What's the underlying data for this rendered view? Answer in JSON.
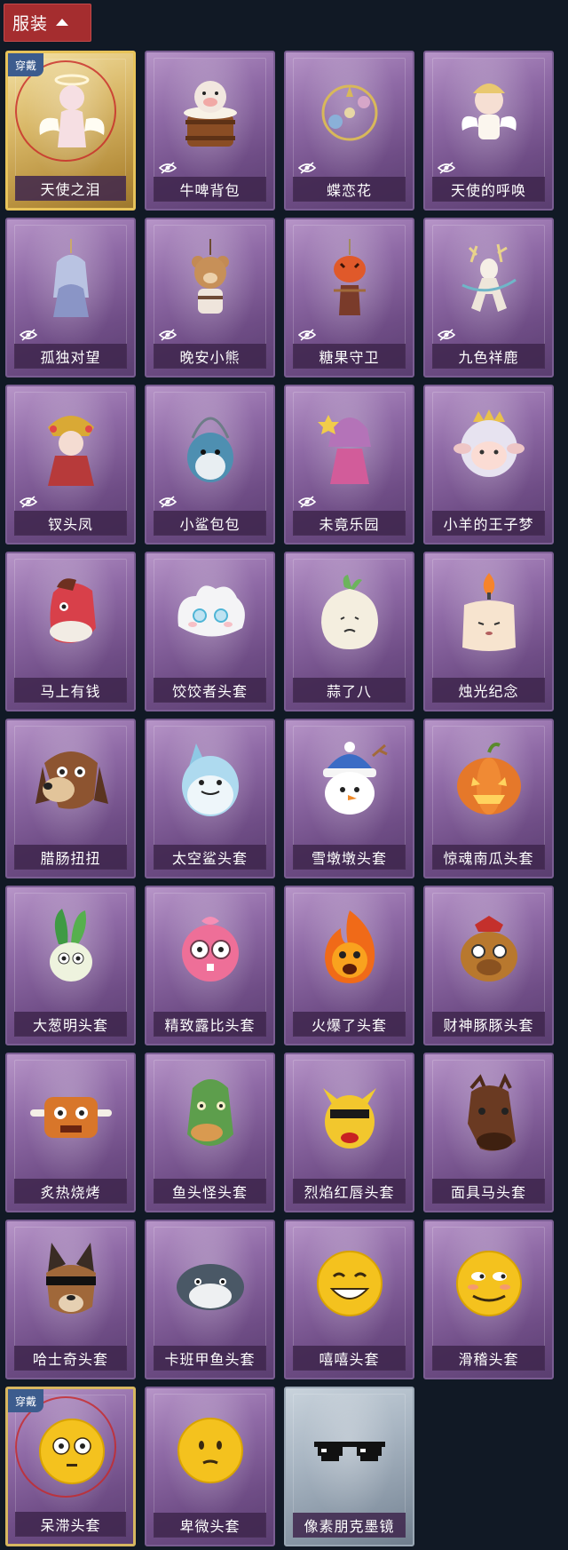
{
  "header": {
    "tab_label": "服装"
  },
  "badges": {
    "wearing": "穿戴"
  },
  "items": [
    {
      "name": "天使之泪",
      "style": "gold",
      "wearing": true,
      "hidden": false,
      "icon": "angel-icon"
    },
    {
      "name": "牛啤背包",
      "style": "purple",
      "wearing": false,
      "hidden": true,
      "icon": "cow-barrel-icon"
    },
    {
      "name": "蝶恋花",
      "style": "purple",
      "wearing": false,
      "hidden": true,
      "icon": "flower-charm-icon"
    },
    {
      "name": "天使的呼唤",
      "style": "purple",
      "wearing": false,
      "hidden": true,
      "icon": "cherub-icon"
    },
    {
      "name": "孤独对望",
      "style": "purple",
      "wearing": false,
      "hidden": true,
      "icon": "doll-charm-icon"
    },
    {
      "name": "晚安小熊",
      "style": "purple",
      "wearing": false,
      "hidden": true,
      "icon": "bear-charm-icon"
    },
    {
      "name": "糖果守卫",
      "style": "purple",
      "wearing": false,
      "hidden": true,
      "icon": "pumpkin-charm-icon"
    },
    {
      "name": "九色祥鹿",
      "style": "purple",
      "wearing": false,
      "hidden": true,
      "icon": "deer-charm-icon"
    },
    {
      "name": "钗头凤",
      "style": "purple",
      "wearing": false,
      "hidden": true,
      "icon": "phoenix-doll-icon"
    },
    {
      "name": "小鲨包包",
      "style": "purple",
      "wearing": false,
      "hidden": true,
      "icon": "shark-bag-icon"
    },
    {
      "name": "未竟乐园",
      "style": "purple",
      "wearing": false,
      "hidden": true,
      "icon": "girl-doll-icon"
    },
    {
      "name": "小羊的王子梦",
      "style": "purple",
      "wearing": false,
      "hidden": false,
      "icon": "sheep-crown-icon"
    },
    {
      "name": "马上有钱",
      "style": "purple",
      "wearing": false,
      "hidden": false,
      "icon": "horse-mask-icon"
    },
    {
      "name": "饺饺者头套",
      "style": "purple",
      "wearing": false,
      "hidden": false,
      "icon": "dumpling-mask-icon"
    },
    {
      "name": "蒜了八",
      "style": "purple",
      "wearing": false,
      "hidden": false,
      "icon": "garlic-mask-icon"
    },
    {
      "name": "烛光纪念",
      "style": "purple",
      "wearing": false,
      "hidden": false,
      "icon": "candle-mask-icon"
    },
    {
      "name": "腊肠扭扭",
      "style": "purple",
      "wearing": false,
      "hidden": false,
      "icon": "dog-mask-icon"
    },
    {
      "name": "太空鲨头套",
      "style": "purple",
      "wearing": false,
      "hidden": false,
      "icon": "space-shark-icon"
    },
    {
      "name": "雪墩墩头套",
      "style": "purple",
      "wearing": false,
      "hidden": false,
      "icon": "snowman-mask-icon"
    },
    {
      "name": "惊魂南瓜头套",
      "style": "purple",
      "wearing": false,
      "hidden": false,
      "icon": "pumpkin-mask-icon"
    },
    {
      "name": "大葱明头套",
      "style": "purple",
      "wearing": false,
      "hidden": false,
      "icon": "scallion-mask-icon"
    },
    {
      "name": "精致露比头套",
      "style": "purple",
      "wearing": false,
      "hidden": false,
      "icon": "pink-beaver-icon"
    },
    {
      "name": "火爆了头套",
      "style": "purple",
      "wearing": false,
      "hidden": false,
      "icon": "fire-mask-icon"
    },
    {
      "name": "财神豚豚头套",
      "style": "purple",
      "wearing": false,
      "hidden": false,
      "icon": "capybara-mask-icon"
    },
    {
      "name": "炙热烧烤",
      "style": "purple",
      "wearing": false,
      "hidden": false,
      "icon": "bbq-mask-icon"
    },
    {
      "name": "鱼头怪头套",
      "style": "purple",
      "wearing": false,
      "hidden": false,
      "icon": "fish-mask-icon"
    },
    {
      "name": "烈焰红唇头套",
      "style": "purple",
      "wearing": false,
      "hidden": false,
      "icon": "yellow-mask-icon"
    },
    {
      "name": "面具马头套",
      "style": "purple",
      "wearing": false,
      "hidden": false,
      "icon": "horse-head-icon"
    },
    {
      "name": "哈士奇头套",
      "style": "purple",
      "wearing": false,
      "hidden": false,
      "icon": "husky-mask-icon"
    },
    {
      "name": "卡班甲鱼头套",
      "style": "purple",
      "wearing": false,
      "hidden": false,
      "icon": "seal-mask-icon"
    },
    {
      "name": "嘻嘻头套",
      "style": "purple",
      "wearing": false,
      "hidden": false,
      "icon": "grin-emoji-icon"
    },
    {
      "name": "滑稽头套",
      "style": "purple",
      "wearing": false,
      "hidden": false,
      "icon": "smirk-emoji-icon"
    },
    {
      "name": "呆滞头套",
      "style": "blue-gold",
      "wearing": true,
      "hidden": false,
      "icon": "dazed-emoji-icon"
    },
    {
      "name": "卑微头套",
      "style": "purple",
      "wearing": false,
      "hidden": false,
      "icon": "humble-emoji-icon"
    },
    {
      "name": "像素朋克墨镜",
      "style": "silver",
      "wearing": false,
      "hidden": false,
      "icon": "pixel-glasses-icon"
    }
  ],
  "colors": {
    "background": "#111925",
    "tab_red": "#a52d2f",
    "card_purple": "#8f6aa6",
    "card_gold": "#d9b868",
    "card_silver": "#a8b5c2",
    "badge_blue": "#3c5c8e"
  }
}
